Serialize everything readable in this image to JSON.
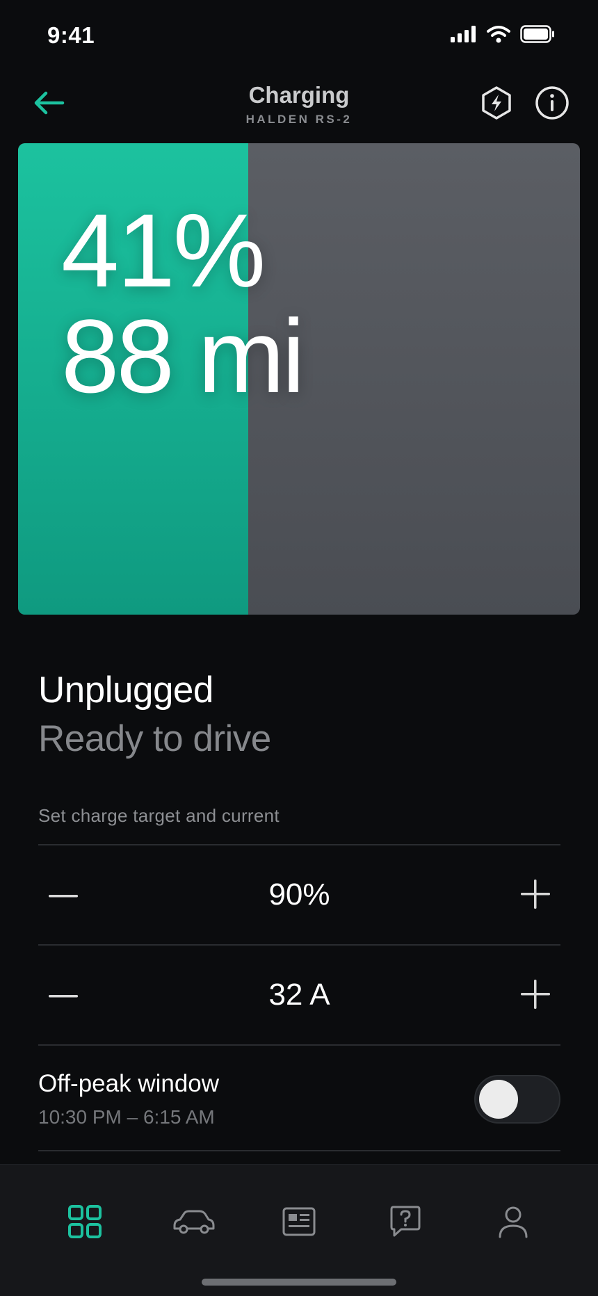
{
  "status_bar": {
    "time": "9:41",
    "icons": [
      "cellular-signal-icon",
      "wifi-icon",
      "battery-icon"
    ]
  },
  "header": {
    "title": "Charging",
    "subtitle": "HALDEN RS-2",
    "icons": [
      "back-arrow-icon",
      "hexagon-bolt-icon",
      "info-icon"
    ]
  },
  "battery": {
    "percent_label": "41%",
    "range_label": "88 mi",
    "fill_fraction": 0.41
  },
  "charge_state": {
    "title": "Unplugged",
    "subtitle": "Ready to drive"
  },
  "settings": {
    "caption": "Set charge target and current",
    "target": {
      "value": "90%"
    },
    "current": {
      "value": "32 A"
    },
    "off_peak": {
      "title": "Off-peak window",
      "time_range": "10:30 PM – 6:15 AM",
      "enabled": false
    }
  },
  "tabbar": {
    "tabs": [
      {
        "icon": "grid-icon",
        "active": true
      },
      {
        "icon": "car-icon",
        "active": false
      },
      {
        "icon": "news-icon",
        "active": false
      },
      {
        "icon": "help-chat-icon",
        "active": false
      },
      {
        "icon": "profile-icon",
        "active": false
      }
    ]
  },
  "colors": {
    "accent": "#1cc29f",
    "background": "#0b0c0e",
    "card_empty": "#54575d",
    "muted_text": "#86888c"
  }
}
